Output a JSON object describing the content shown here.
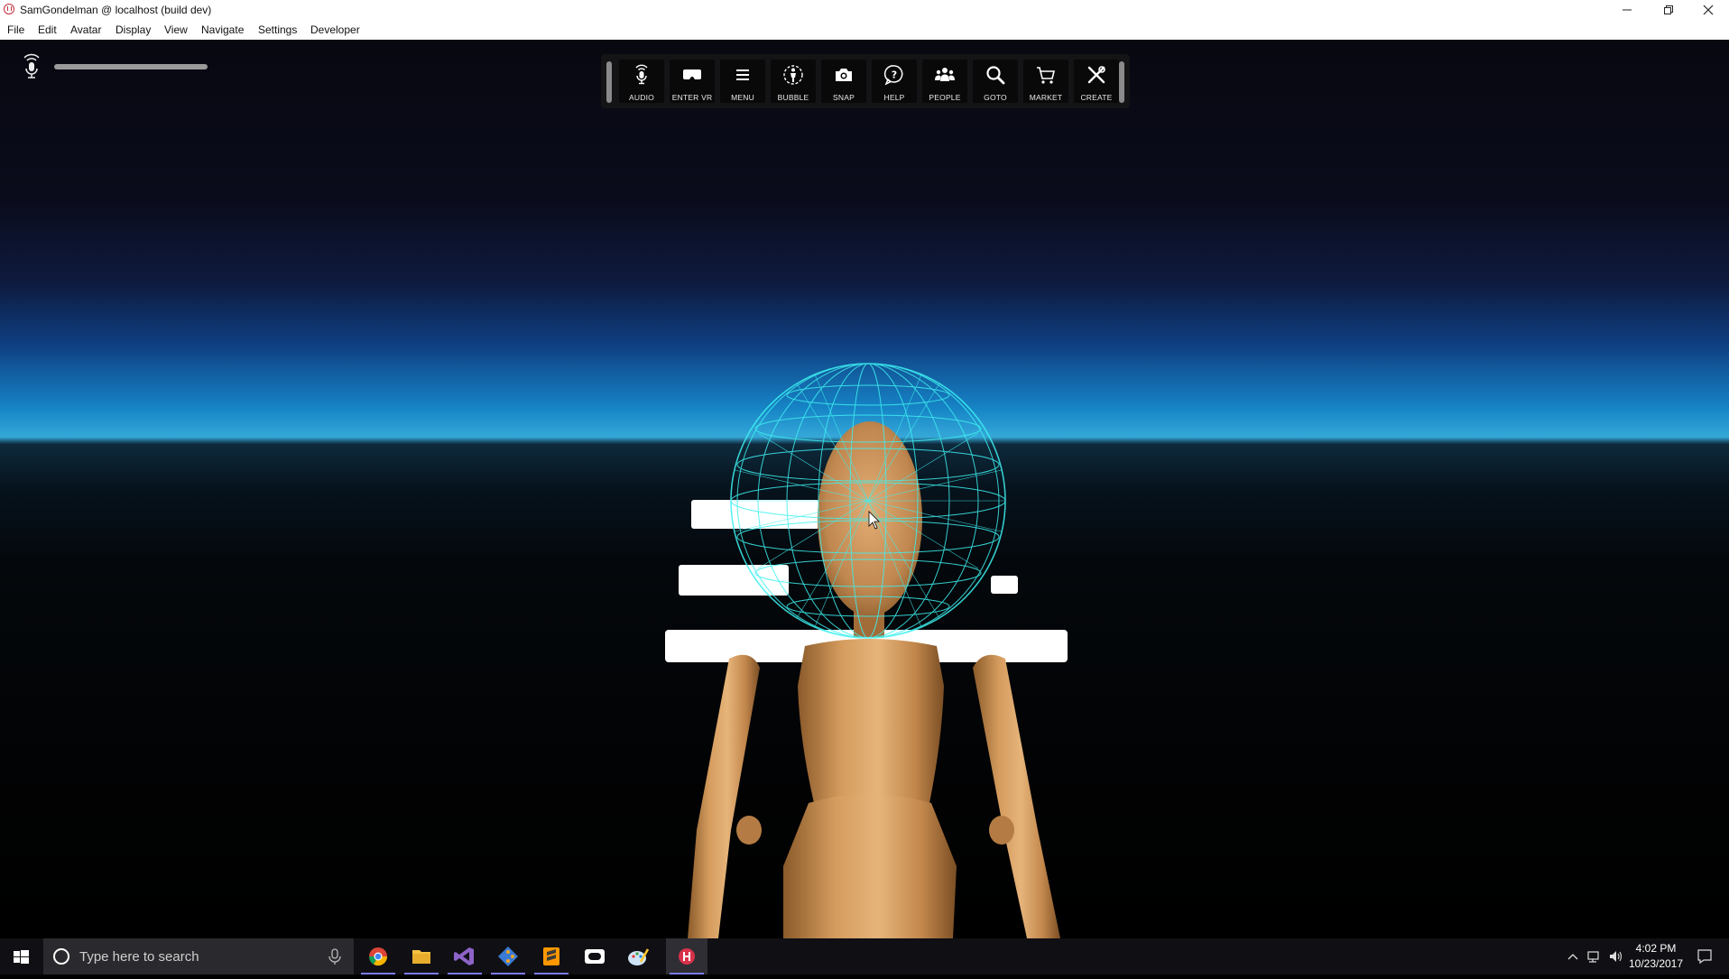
{
  "window": {
    "title": "SamGondelman @ localhost (build dev)"
  },
  "menubar": {
    "items": [
      "File",
      "Edit",
      "Avatar",
      "Display",
      "View",
      "Navigate",
      "Settings",
      "Developer"
    ]
  },
  "hud": {
    "audio_level": 0.0,
    "mic_icon": "microphone-icon"
  },
  "toolbar": {
    "buttons": [
      {
        "label": "AUDIO",
        "icon": "microphone-icon"
      },
      {
        "label": "ENTER VR",
        "icon": "vr-headset-icon"
      },
      {
        "label": "MENU",
        "icon": "hamburger-menu-icon"
      },
      {
        "label": "BUBBLE",
        "icon": "bubble-person-icon"
      },
      {
        "label": "SNAP",
        "icon": "camera-icon"
      },
      {
        "label": "HELP",
        "icon": "help-icon"
      },
      {
        "label": "PEOPLE",
        "icon": "people-icon"
      },
      {
        "label": "GOTO",
        "icon": "magnifier-icon"
      },
      {
        "label": "MARKET",
        "icon": "cart-icon"
      },
      {
        "label": "CREATE",
        "icon": "tools-icon"
      }
    ]
  },
  "taskbar": {
    "search_placeholder": "Type here to search",
    "apps": [
      "chrome-icon",
      "file-explorer-icon",
      "visual-studio-icon",
      "git-icon",
      "sublime-text-icon",
      "oculus-icon",
      "paint-icon",
      "high-fidelity-icon"
    ],
    "time": "4:02 PM",
    "date": "10/23/2017"
  },
  "colors": {
    "sky_horizon": "#35a8d8",
    "wireframe": "#3ef0f0",
    "toolbar_bg": "#181818",
    "taskbar_accent": "#7c7cff"
  }
}
